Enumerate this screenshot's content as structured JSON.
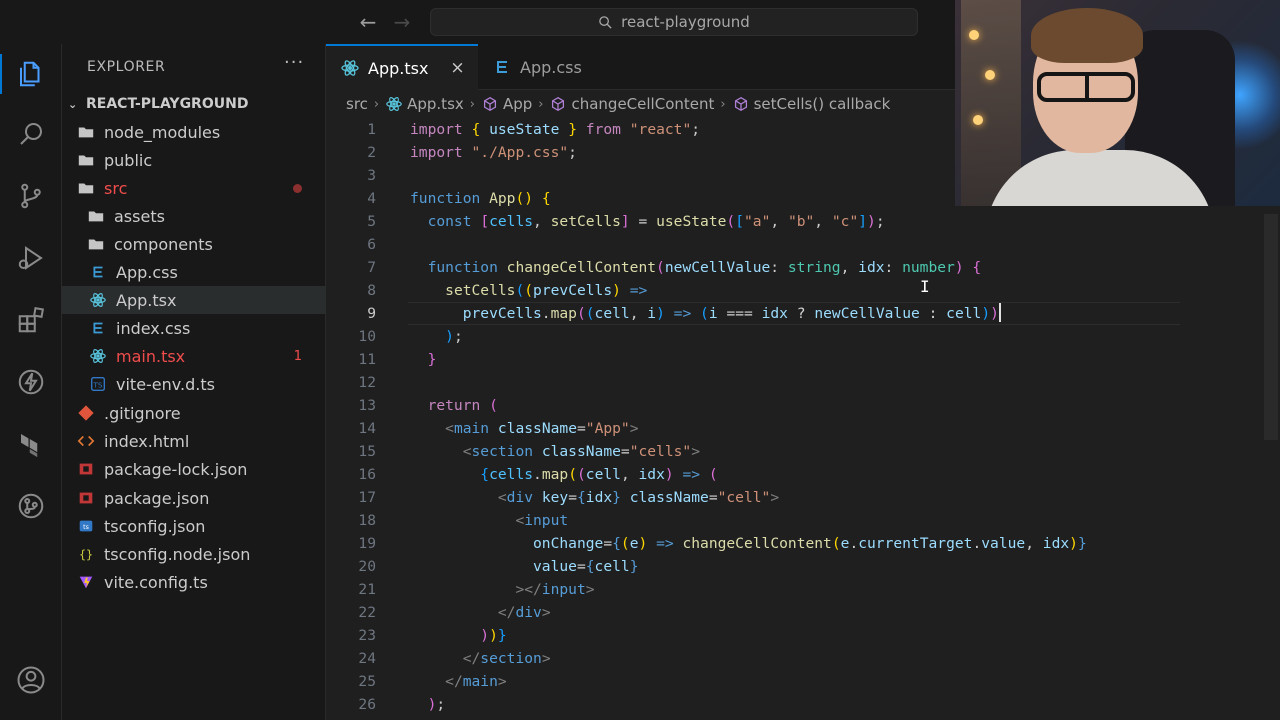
{
  "window": {
    "search_text": "react-playground",
    "back_icon": "arrow-left-icon",
    "forward_icon": "arrow-right-icon"
  },
  "activity_bar": {
    "items": [
      "explorer-icon",
      "search-icon",
      "source-control-icon",
      "run-debug-icon",
      "extensions-icon",
      "lightning-icon",
      "terraform-icon",
      "git-graph-icon"
    ],
    "bottom": [
      "account-icon"
    ]
  },
  "sidebar": {
    "title": "EXPLORER",
    "more": "···",
    "root": "REACT-PLAYGROUND",
    "items": [
      {
        "label": "node_modules",
        "icon": "folder-icon"
      },
      {
        "label": "public",
        "icon": "folder-icon"
      },
      {
        "label": "src",
        "icon": "folder-icon"
      },
      {
        "label": "assets",
        "icon": "folder-icon"
      },
      {
        "label": "components",
        "icon": "folder-icon"
      },
      {
        "label": "App.css",
        "icon": "css-file-icon"
      },
      {
        "label": "App.tsx",
        "icon": "react-file-icon"
      },
      {
        "label": "index.css",
        "icon": "css-file-icon"
      },
      {
        "label": "main.tsx",
        "icon": "react-file-icon",
        "badge": "1"
      },
      {
        "label": "vite-env.d.ts",
        "icon": "ts-file-icon"
      },
      {
        "label": ".gitignore",
        "icon": "git-file-icon"
      },
      {
        "label": "index.html",
        "icon": "html-file-icon"
      },
      {
        "label": "package-lock.json",
        "icon": "npm-file-icon"
      },
      {
        "label": "package.json",
        "icon": "npm-file-icon"
      },
      {
        "label": "tsconfig.json",
        "icon": "tsconfig-file-icon"
      },
      {
        "label": "tsconfig.node.json",
        "icon": "json-file-icon"
      },
      {
        "label": "vite.config.ts",
        "icon": "vite-file-icon"
      }
    ]
  },
  "tabs": [
    {
      "label": "App.tsx",
      "close": "×"
    },
    {
      "label": "App.css"
    }
  ],
  "breadcrumb": [
    "src",
    "App.tsx",
    "App",
    "changeCellContent",
    "setCells() callback"
  ],
  "breadcrumb_sep": "›",
  "code": {
    "line_numbers": [
      "1",
      "2",
      "3",
      "4",
      "5",
      "6",
      "7",
      "8",
      "9",
      "10",
      "11",
      "12",
      "13",
      "14",
      "15",
      "16",
      "17",
      "18",
      "19",
      "20",
      "21",
      "22",
      "23",
      "24",
      "25",
      "26"
    ]
  },
  "colors": {
    "accent": "#0078d4",
    "error": "#f14c4c",
    "editor_bg": "#1f1f1f",
    "sidebar_bg": "#181818"
  }
}
